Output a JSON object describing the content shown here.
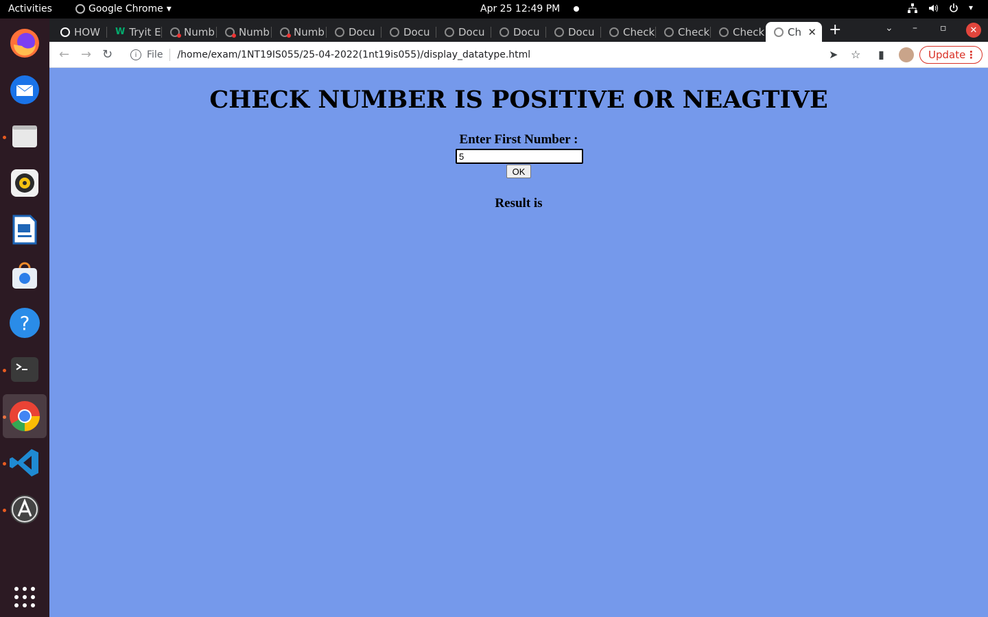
{
  "topbar": {
    "activities": "Activities",
    "app_name": "Google Chrome",
    "clock": "Apr 25  12:49 PM"
  },
  "dock": {
    "apps": [
      "firefox-icon",
      "thunderbird-icon",
      "files-icon",
      "rhythmbox-icon",
      "writer-icon",
      "software-icon",
      "help-icon",
      "terminal-icon",
      "chrome-icon",
      "vscode-icon",
      "updater-icon",
      "app-grid-icon"
    ]
  },
  "tabs": [
    {
      "label": "HOW"
    },
    {
      "label": "Tryit E"
    },
    {
      "label": "Numb"
    },
    {
      "label": "Numb"
    },
    {
      "label": "Numb"
    },
    {
      "label": "Docu"
    },
    {
      "label": "Docu"
    },
    {
      "label": "Docu"
    },
    {
      "label": "Docu"
    },
    {
      "label": "Docu"
    },
    {
      "label": "Check"
    },
    {
      "label": "Check"
    },
    {
      "label": "Check"
    },
    {
      "label": "Ch"
    }
  ],
  "toolbar": {
    "scheme": "File",
    "url": "/home/exam/1NT19IS055/25-04-2022(1nt19is055)/display_datatype.html",
    "update_label": "Update"
  },
  "page": {
    "title": "CHECK NUMBER IS POSITIVE OR NEAGTIVE",
    "label": "Enter First Number :",
    "input_value": "5",
    "ok_label": "OK",
    "result_label": "Result is"
  }
}
